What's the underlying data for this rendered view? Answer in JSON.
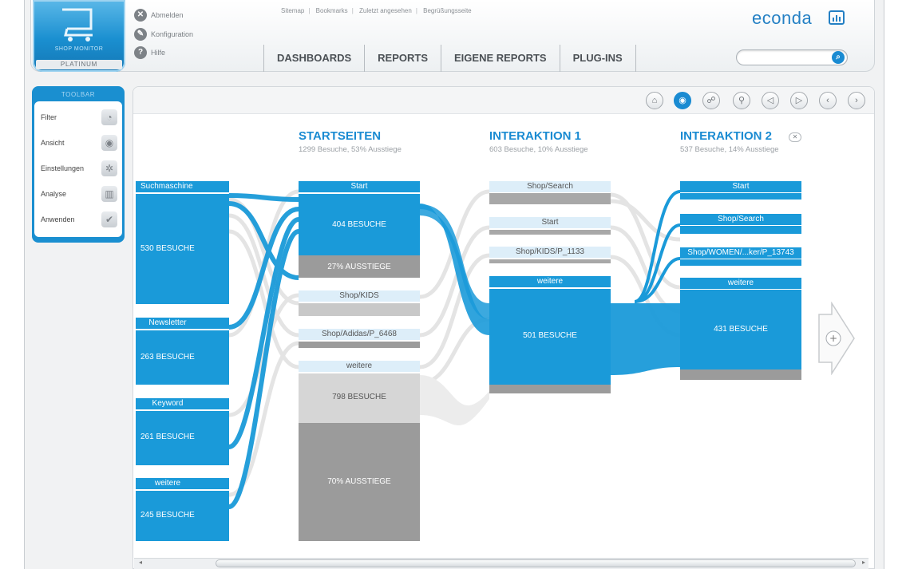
{
  "header": {
    "product_label": "SHOP MONITOR",
    "edition": "PLATINUM",
    "account": [
      {
        "label": "Abmelden",
        "icon": "close-icon"
      },
      {
        "label": "Konfiguration",
        "icon": "wrench-icon"
      },
      {
        "label": "Hilfe",
        "icon": "help-icon"
      }
    ],
    "top_links": [
      "Sitemap",
      "Bookmarks",
      "Zuletzt angesehen",
      "Begrüßungsseite"
    ],
    "tabs": [
      "DASHBOARDS",
      "REPORTS",
      "EIGENE REPORTS",
      "PLUG-INS"
    ],
    "brand": "econda",
    "search": {
      "value": ""
    }
  },
  "toolbar": {
    "title": "TOOLBAR",
    "items": [
      {
        "label": "Filter",
        "icon": "filter-icon"
      },
      {
        "label": "Ansicht",
        "icon": "eye-icon"
      },
      {
        "label": "Einstellungen",
        "icon": "gear-icon"
      },
      {
        "label": "Analyse",
        "icon": "chart-icon"
      },
      {
        "label": "Anwenden",
        "icon": "check-icon"
      }
    ]
  },
  "panel_buttons": [
    "home-icon",
    "eye-icon",
    "walker-icon",
    "zoom-icon",
    "step-back-icon",
    "step-forward-icon",
    "prev-icon",
    "next-icon"
  ],
  "columns": [
    {
      "title": "STARTSEITEN",
      "sub": "1299 Besuche, 53% Ausstiege"
    },
    {
      "title": "INTERAKTION 1",
      "sub": "603 Besuche, 10% Ausstiege"
    },
    {
      "title": "INTERAKTION 2",
      "sub": "537 Besuche, 14% Ausstiege"
    }
  ],
  "sources": [
    {
      "name": "Suchmaschine",
      "visits": "530 BESUCHE"
    },
    {
      "name": "Newsletter",
      "visits": "263 BESUCHE"
    },
    {
      "name": "Keyword",
      "visits": "261 BESUCHE"
    },
    {
      "name": "weitere",
      "visits": "245 BESUCHE"
    }
  ],
  "start_pages": {
    "start": {
      "name": "Start",
      "visits": "404 BESUCHE",
      "exits": "27% AUSSTIEGE"
    },
    "kids": {
      "name": "Shop/KIDS"
    },
    "adidas": {
      "name": "Shop/Adidas/P_6468"
    },
    "weitere": {
      "name": "weitere",
      "visits": "798 BESUCHE",
      "exits": "70% AUSSTIEGE"
    }
  },
  "interaction1": {
    "search": {
      "name": "Shop/Search"
    },
    "start": {
      "name": "Start"
    },
    "kids": {
      "name": "Shop/KIDS/P_1133"
    },
    "weitere": {
      "name": "weitere",
      "visits": "501 BESUCHE"
    }
  },
  "interaction2": {
    "start": {
      "name": "Start"
    },
    "search": {
      "name": "Shop/Search"
    },
    "women": {
      "name": "Shop/WOMEN/...ker/P_13743"
    },
    "weitere": {
      "name": "weitere",
      "visits": "431 BESUCHE"
    }
  },
  "colors": {
    "blue": "#1a9ad9",
    "light_blue": "#ddeef9",
    "gray": "#9b9b9b",
    "light_gray": "#d6d6d6"
  }
}
